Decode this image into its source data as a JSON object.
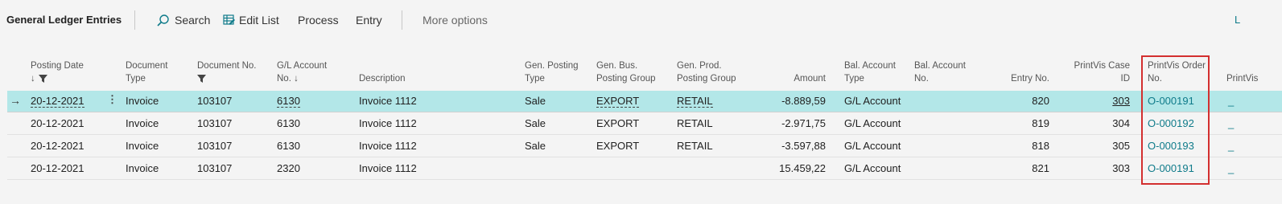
{
  "toolbar": {
    "title": "General Ledger Entries",
    "search_label": "Search",
    "edit_list_label": "Edit List",
    "process_label": "Process",
    "entry_label": "Entry",
    "more_options_label": "More options",
    "right_cut_label": "L"
  },
  "columns": {
    "posting_date": [
      "Posting Date",
      "↓"
    ],
    "document_type": [
      "Document",
      "Type"
    ],
    "document_no": [
      "Document No."
    ],
    "gl_account_no": [
      "G/L Account",
      "No. ↓"
    ],
    "description": [
      "Description"
    ],
    "gen_posting_type": [
      "Gen. Posting",
      "Type"
    ],
    "gen_bus_posting_group": [
      "Gen. Bus.",
      "Posting Group"
    ],
    "gen_prod_posting_group": [
      "Gen. Prod.",
      "Posting Group"
    ],
    "amount": [
      "Amount"
    ],
    "bal_account_type": [
      "Bal. Account",
      "Type"
    ],
    "bal_account_no": [
      "Bal. Account",
      "No."
    ],
    "entry_no": [
      "Entry No."
    ],
    "printvis_case_id": [
      "PrintVis Case",
      "ID"
    ],
    "printvis_order_no": [
      "PrintVis Order",
      "No."
    ],
    "printvis_cut": [
      "PrintVis"
    ]
  },
  "rows": [
    {
      "posting_date": "20-12-2021",
      "document_type": "Invoice",
      "document_no": "103107",
      "gl_account_no": "6130",
      "description": "Invoice 1112",
      "gen_posting_type": "Sale",
      "gen_bus_posting_group": "EXPORT",
      "gen_prod_posting_group": "RETAIL",
      "amount": "-8.889,59",
      "bal_account_type": "G/L Account",
      "bal_account_no": "",
      "entry_no": "820",
      "printvis_case_id": "303",
      "printvis_order_no": "O-000191",
      "printvis_cut": "_",
      "selected": true
    },
    {
      "posting_date": "20-12-2021",
      "document_type": "Invoice",
      "document_no": "103107",
      "gl_account_no": "6130",
      "description": "Invoice 1112",
      "gen_posting_type": "Sale",
      "gen_bus_posting_group": "EXPORT",
      "gen_prod_posting_group": "RETAIL",
      "amount": "-2.971,75",
      "bal_account_type": "G/L Account",
      "bal_account_no": "",
      "entry_no": "819",
      "printvis_case_id": "304",
      "printvis_order_no": "O-000192",
      "printvis_cut": "_",
      "selected": false
    },
    {
      "posting_date": "20-12-2021",
      "document_type": "Invoice",
      "document_no": "103107",
      "gl_account_no": "6130",
      "description": "Invoice 1112",
      "gen_posting_type": "Sale",
      "gen_bus_posting_group": "EXPORT",
      "gen_prod_posting_group": "RETAIL",
      "amount": "-3.597,88",
      "bal_account_type": "G/L Account",
      "bal_account_no": "",
      "entry_no": "818",
      "printvis_case_id": "305",
      "printvis_order_no": "O-000193",
      "printvis_cut": "_",
      "selected": false
    },
    {
      "posting_date": "20-12-2021",
      "document_type": "Invoice",
      "document_no": "103107",
      "gl_account_no": "2320",
      "description": "Invoice 1112",
      "gen_posting_type": "",
      "gen_bus_posting_group": "",
      "gen_prod_posting_group": "",
      "amount": "15.459,22",
      "bal_account_type": "G/L Account",
      "bal_account_no": "",
      "entry_no": "821",
      "printvis_case_id": "303",
      "printvis_order_no": "O-000191",
      "printvis_cut": "_",
      "selected": false
    }
  ],
  "colors": {
    "accent": "#0f7b8a",
    "selected_row": "#b3e7e8",
    "highlight_box": "#d32f2f"
  },
  "icons": {
    "search": "search-icon",
    "edit_list": "edit-list-icon",
    "filter": "filter-icon",
    "row_arrow": "arrow-right-icon",
    "row_menu": "vertical-ellipsis-icon"
  }
}
